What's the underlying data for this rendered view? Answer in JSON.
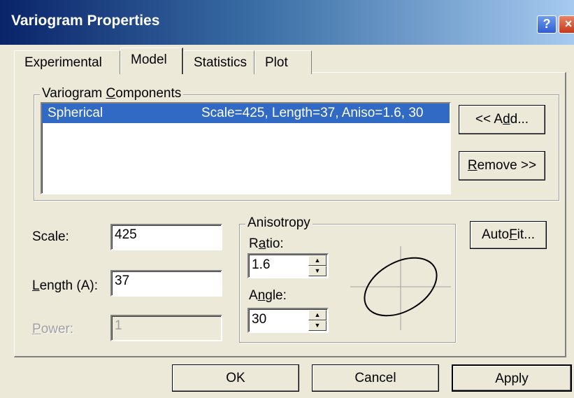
{
  "window": {
    "title": "Variogram Properties",
    "help_label": "?",
    "close_label": "×"
  },
  "tabs": [
    {
      "label": "Experimental",
      "active": false
    },
    {
      "label": "Model",
      "active": true
    },
    {
      "label": "Statistics",
      "active": false
    },
    {
      "label": "Plot",
      "active": false
    }
  ],
  "components": {
    "legend_prefix": "Variogram ",
    "legend_underlined": "C",
    "legend_suffix": "omponents",
    "items": [
      {
        "name": "Spherical",
        "params": "Scale=425, Length=37, Aniso=1.6, 30",
        "selected": true
      }
    ],
    "add_button": {
      "prefix": "<<  A",
      "underlined": "d",
      "suffix": "d..."
    },
    "remove_button": {
      "prefix": "",
      "underlined": "R",
      "suffix": "emove >>"
    }
  },
  "params": {
    "scale_label": "Scale:",
    "scale_value": "425",
    "length_underlined": "L",
    "length_suffix": "ength (A):",
    "length_value": "37",
    "power_underlined": "P",
    "power_suffix": "ower:",
    "power_value": "1"
  },
  "anisotropy": {
    "legend": "Anisotropy",
    "ratio_prefix": "R",
    "ratio_underlined": "a",
    "ratio_suffix": "tio:",
    "ratio_value": "1.6",
    "angle_prefix": "A",
    "angle_underlined": "n",
    "angle_suffix": "gle:",
    "angle_value": "30",
    "ellipse_ratio": 1.6,
    "ellipse_angle_deg": 30
  },
  "autofit_button": {
    "prefix": "Auto",
    "underlined": "F",
    "suffix": "it..."
  },
  "footer": {
    "ok_label": "OK",
    "cancel_label": "Cancel",
    "apply_label": "Apply"
  },
  "colors": {
    "selection": "#316AC5",
    "dialog_face": "#ECE9D8"
  }
}
